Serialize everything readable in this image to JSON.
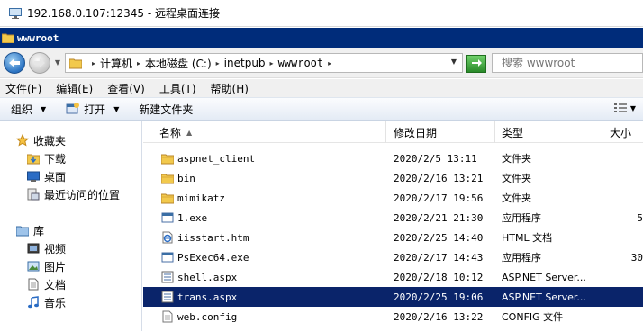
{
  "rdp": {
    "title": "192.168.0.107:12345 - 远程桌面连接"
  },
  "window": {
    "title": "wwwroot"
  },
  "address": {
    "crumbs": [
      "计算机",
      "本地磁盘 (C:)",
      "inetpub",
      "wwwroot"
    ],
    "search_placeholder": "搜索 wwwroot"
  },
  "menu": [
    "文件(F)",
    "编辑(E)",
    "查看(V)",
    "工具(T)",
    "帮助(H)"
  ],
  "toolbar": {
    "organize": "组织",
    "open": "打开",
    "new_folder": "新建文件夹"
  },
  "nav": {
    "favorites": "收藏夹",
    "downloads": "下载",
    "desktop": "桌面",
    "recent": "最近访问的位置",
    "libraries": "库",
    "videos": "视频",
    "pictures": "图片",
    "documents": "文档",
    "music": "音乐"
  },
  "columns": {
    "name": "名称",
    "date": "修改日期",
    "type": "类型",
    "size": "大小"
  },
  "files": [
    {
      "name": "aspnet_client",
      "date": "2020/2/5 13:11",
      "type": "文件夹",
      "size": "",
      "icon": "folder-icon",
      "selected": false
    },
    {
      "name": "bin",
      "date": "2020/2/16 13:21",
      "type": "文件夹",
      "size": "",
      "icon": "folder-icon",
      "selected": false
    },
    {
      "name": "mimikatz",
      "date": "2020/2/17 19:56",
      "type": "文件夹",
      "size": "",
      "icon": "folder-icon",
      "selected": false
    },
    {
      "name": "1.exe",
      "date": "2020/2/21 21:30",
      "type": "应用程序",
      "size": "5",
      "icon": "application-icon",
      "selected": false
    },
    {
      "name": "iisstart.htm",
      "date": "2020/2/25 14:40",
      "type": "HTML 文档",
      "size": "",
      "icon": "ie-document-icon",
      "selected": false
    },
    {
      "name": "PsExec64.exe",
      "date": "2020/2/17 14:43",
      "type": "应用程序",
      "size": "30",
      "icon": "application-icon",
      "selected": false
    },
    {
      "name": "shell.aspx",
      "date": "2020/2/18 10:12",
      "type": "ASP.NET Server...",
      "size": "",
      "icon": "aspx-file-icon",
      "selected": false
    },
    {
      "name": "trans.aspx",
      "date": "2020/2/25 19:06",
      "type": "ASP.NET Server...",
      "size": "",
      "icon": "aspx-file-icon",
      "selected": true
    },
    {
      "name": "web.config",
      "date": "2020/2/16 13:22",
      "type": "CONFIG 文件",
      "size": "",
      "icon": "config-file-icon",
      "selected": false
    }
  ],
  "colors": {
    "title_bg": "#002c7a",
    "selection_bg": "#0a246a",
    "toolbar_bg": "#e4ebf5"
  }
}
